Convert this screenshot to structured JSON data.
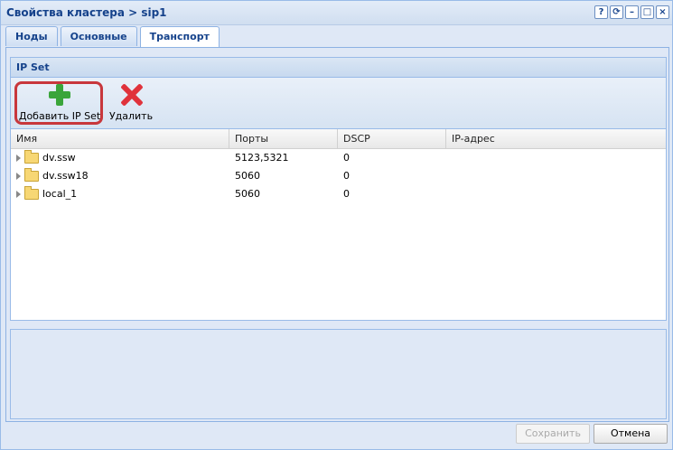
{
  "window": {
    "title": "Свойства кластера > sip1"
  },
  "tabs": [
    {
      "label": "Ноды"
    },
    {
      "label": "Основные"
    },
    {
      "label": "Транспорт"
    }
  ],
  "panel": {
    "title": "IP Set"
  },
  "toolbar": {
    "add_label": "Добавить IP Set",
    "delete_label": "Удалить"
  },
  "grid": {
    "headers": [
      "Имя",
      "Порты",
      "DSCP",
      "IP-адрес"
    ],
    "rows": [
      {
        "name": "dv.ssw",
        "ports": "5123,5321",
        "dscp": "0",
        "ip": ""
      },
      {
        "name": "dv.ssw18",
        "ports": "5060",
        "dscp": "0",
        "ip": ""
      },
      {
        "name": "local_1",
        "ports": "5060",
        "dscp": "0",
        "ip": ""
      }
    ]
  },
  "footer": {
    "save_label": "Сохранить",
    "cancel_label": "Отмена"
  },
  "icons": {
    "help": "?",
    "refresh": "⟳",
    "minimize": "–",
    "maximize": "□",
    "close": "×"
  }
}
